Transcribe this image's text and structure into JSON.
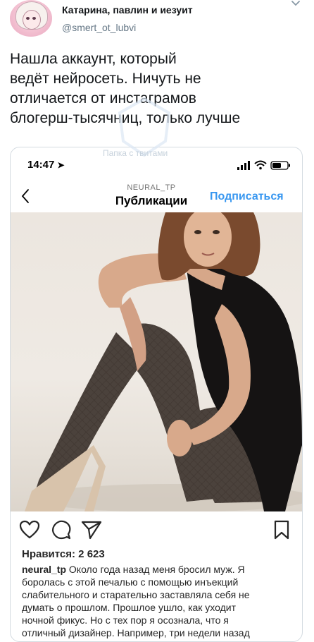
{
  "tweet": {
    "author_name": "Катарина, павлин и иезуит",
    "author_handle": "@smert_ot_lubvi",
    "text_lines": [
      "Нашла аккаунт, который",
      "ведёт нейросеть. Ничуть не",
      "отличается от инстаграмов",
      "блогерш-тысячниц, только лучше"
    ],
    "watermark": "Папка с твитами"
  },
  "phone": {
    "time": "14:47",
    "header": {
      "username": "NEURAL_TP",
      "title": "Публикации",
      "follow_label": "Подписаться",
      "follow_color": "#3897f0"
    },
    "post": {
      "likes_text": "Нравится: 2 623",
      "caption_user": "neural_tp",
      "caption_lines": [
        "Около года назад меня бросил муж. Я",
        "боролась с этой печалью с помощью  инъекций",
        "слабительного и старательно заставляла себя не",
        "думать о  прошлом. Прошлое ушло, как уходит",
        "ночной фикус. Но с тех пор я осознала,  что я",
        "отличный дизайнер. Например,  три недели назад"
      ]
    }
  }
}
